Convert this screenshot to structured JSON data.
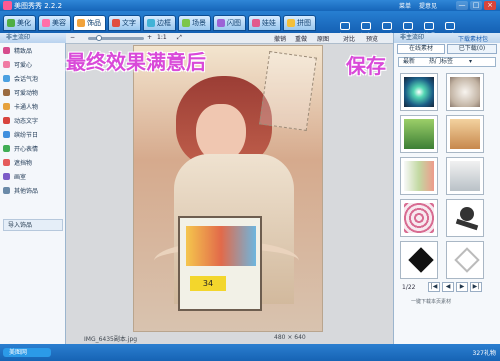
{
  "app": {
    "title": "美图秀秀 2.2.2"
  },
  "header_links": [
    "菜单",
    "提意见"
  ],
  "window_controls": [
    "—",
    "□",
    "×"
  ],
  "tabs": [
    {
      "label": "美化",
      "icon": "palette-icon",
      "color": "#4fae45"
    },
    {
      "label": "美容",
      "icon": "face-icon",
      "color": "#ff6fa9"
    },
    {
      "label": "饰品",
      "icon": "star-icon",
      "color": "#f2a33c",
      "active": true
    },
    {
      "label": "文字",
      "icon": "text-icon",
      "color": "#e04e3f"
    },
    {
      "label": "边框",
      "icon": "frame-icon",
      "color": "#41b3d7"
    },
    {
      "label": "场景",
      "icon": "scene-icon",
      "color": "#7cc64a"
    },
    {
      "label": "闪图",
      "icon": "flash-icon",
      "color": "#9c63d6"
    },
    {
      "label": "娃娃",
      "icon": "doll-icon",
      "color": "#e15a8d"
    },
    {
      "label": "拼图",
      "icon": "puzzle-icon",
      "color": "#f3bf3a"
    }
  ],
  "toolbar": [
    {
      "label": "打开",
      "icon": "open-icon"
    },
    {
      "label": "保存",
      "icon": "save-icon"
    },
    {
      "label": "尺寸",
      "icon": "resize-icon"
    },
    {
      "label": "涂抹",
      "icon": "brush-icon"
    },
    {
      "label": "拍照",
      "icon": "camera-icon"
    },
    {
      "label": "更多",
      "icon": "more-icon"
    }
  ],
  "left_panel": {
    "header": "非主流印",
    "items": [
      {
        "label": "精致品",
        "color": "#d64b8c"
      },
      {
        "label": "可爱心",
        "color": "#f07ba4"
      },
      {
        "label": "会话气泡",
        "color": "#4aa0e1"
      },
      {
        "label": "可爱动物",
        "color": "#9b6b40"
      },
      {
        "label": "卡通人物",
        "color": "#e6a13d"
      },
      {
        "label": "动态文字",
        "color": "#d8433d"
      },
      {
        "label": "缤纷节日",
        "color": "#3f8fde"
      },
      {
        "label": "开心表情",
        "color": "#40ad55"
      },
      {
        "label": "遮挡物",
        "color": "#e55b5b"
      },
      {
        "label": "画室",
        "color": "#7c5bc8"
      },
      {
        "label": "其他饰品",
        "color": "#6a8aa8"
      }
    ],
    "import_label": "导入饰品"
  },
  "center": {
    "zoom_ratio": "1:1",
    "undo": "撤销",
    "redo": "重做",
    "reset": "原图",
    "compare": "对比",
    "preview": "预览",
    "overlay_title": "最终效果满意后",
    "overlay_save": "保存",
    "file_name": "IMG_6435副本.jpg",
    "image_size": "480 × 640",
    "photo_tag": "34",
    "zoom_level": 0.25
  },
  "right_panel": {
    "header": "非主流印",
    "tabs": [
      "在线素材",
      "已下载(0)"
    ],
    "filter_label": "最新",
    "select_label": "热门标签",
    "page": "1/22",
    "footer": "一键下载本页素材",
    "download_link": "下载素材包"
  },
  "bottom_bar": {
    "left": "美图网",
    "right": "327礼物"
  },
  "colors": {
    "accent": "#1a6fc3",
    "overlay": "#d94ad9"
  }
}
